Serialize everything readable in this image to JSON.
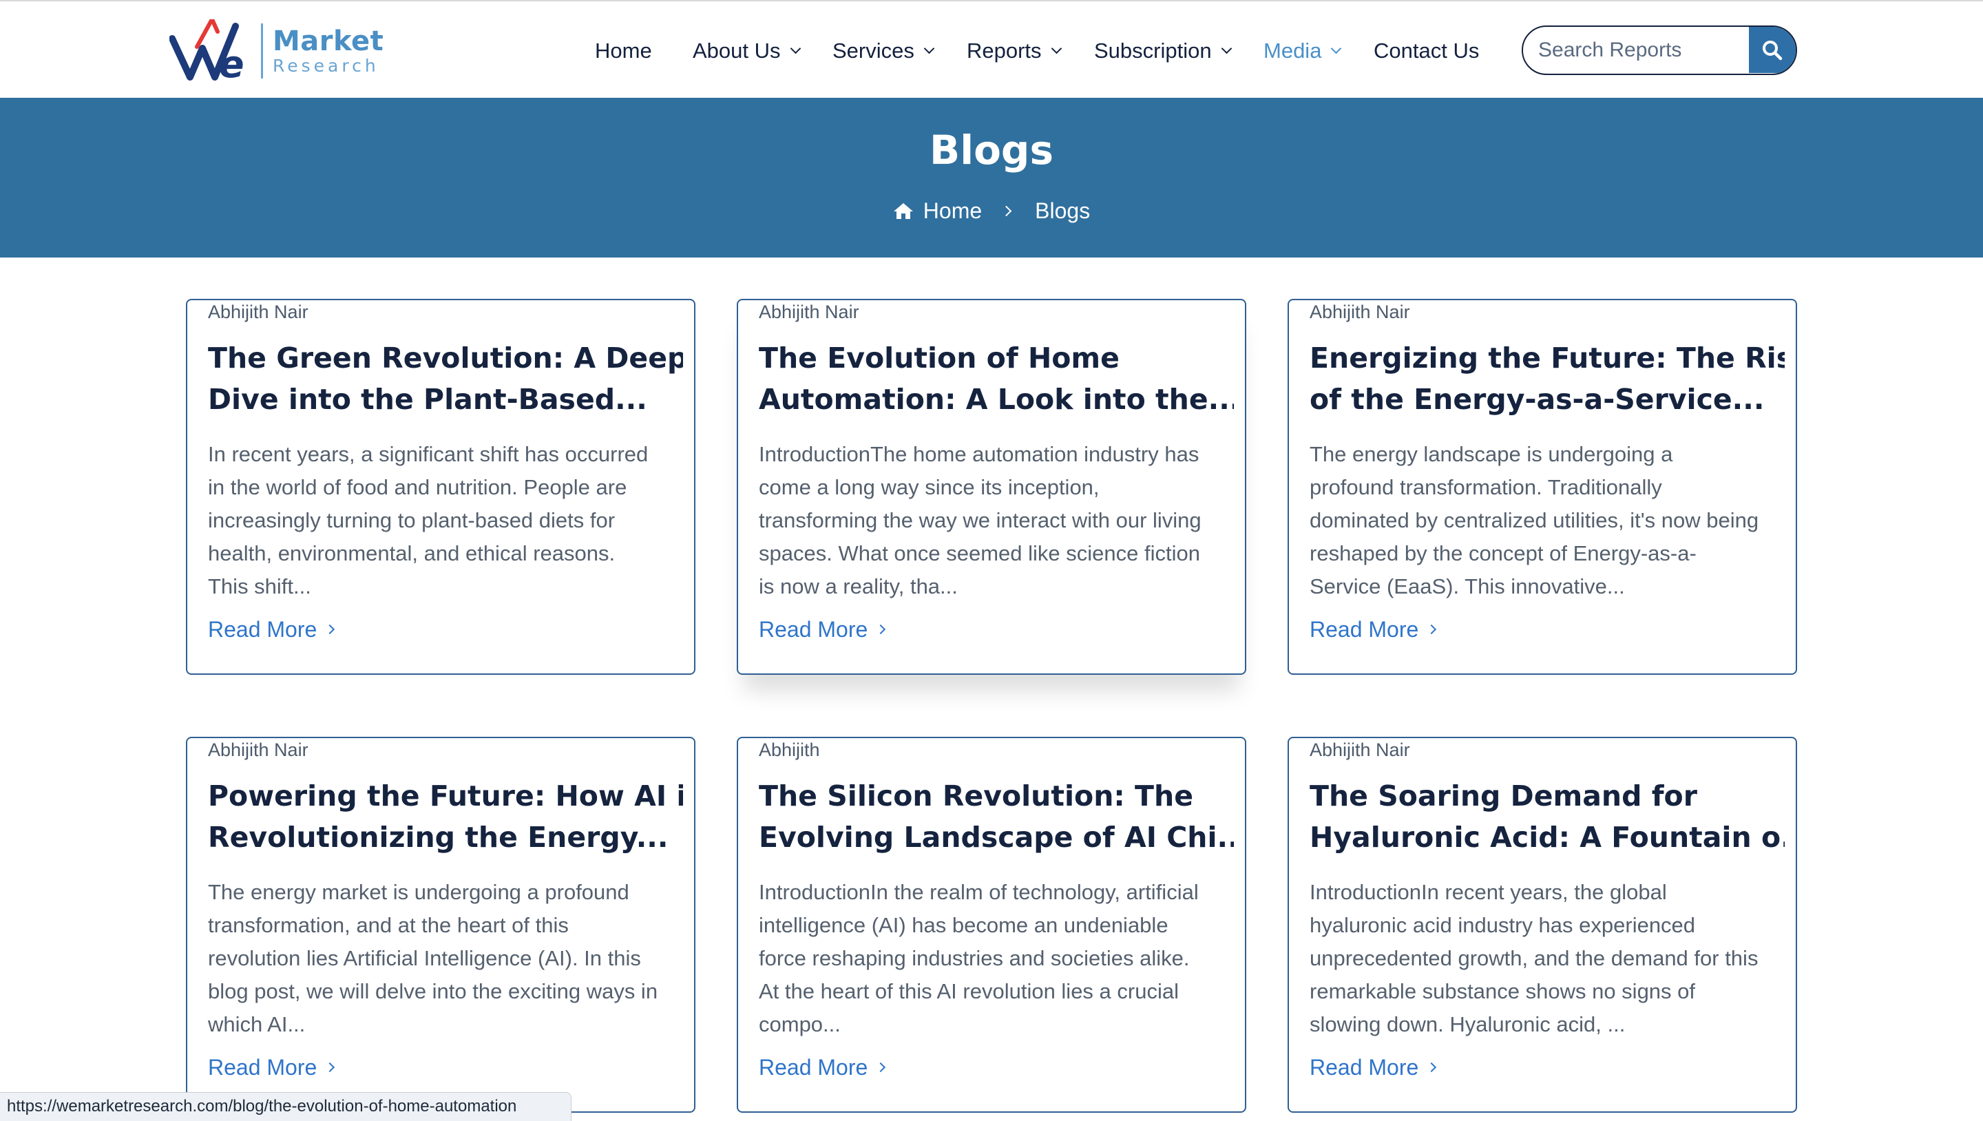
{
  "header": {
    "logo": {
      "mark": "We",
      "market": "Market",
      "research": "Research"
    },
    "nav": [
      {
        "label": "Home",
        "dropdown": false,
        "active": false
      },
      {
        "label": "About Us",
        "dropdown": true,
        "active": false
      },
      {
        "label": "Services",
        "dropdown": true,
        "active": false
      },
      {
        "label": "Reports",
        "dropdown": true,
        "active": false
      },
      {
        "label": "Subscription",
        "dropdown": true,
        "active": false
      },
      {
        "label": "Media",
        "dropdown": true,
        "active": true
      },
      {
        "label": "Contact Us",
        "dropdown": false,
        "active": false
      }
    ],
    "search": {
      "placeholder": "Search Reports",
      "value": "",
      "icon": "search-icon"
    }
  },
  "banner": {
    "title": "Blogs",
    "breadcrumb": {
      "home": "Home",
      "current": "Blogs",
      "home_icon": "home-icon"
    }
  },
  "cards": [
    {
      "author": "Abhijith Nair",
      "title_lines": [
        "The Green Revolution: A Deep",
        "Dive into the Plant-Based..."
      ],
      "excerpt_lines": [
        "In recent years, a significant shift has occurred",
        "in the world of food and nutrition. People are",
        "increasingly turning to plant-based diets for",
        "health, environmental, and ethical reasons.",
        "This shift..."
      ],
      "read_more": "Read More"
    },
    {
      "author": "Abhijith Nair",
      "title_lines": [
        "The Evolution of Home",
        "Automation: A Look into the..."
      ],
      "excerpt_lines": [
        "IntroductionThe home automation industry has",
        "come a long way since its inception,",
        "transforming the way we interact with our living",
        "spaces. What once seemed like science fiction",
        "is now a reality, tha..."
      ],
      "read_more": "Read More"
    },
    {
      "author": "Abhijith Nair",
      "title_lines": [
        "Energizing the Future: The Rise",
        "of the Energy-as-a-Service..."
      ],
      "excerpt_lines": [
        "The energy landscape is undergoing a",
        "profound transformation. Traditionally",
        "dominated by centralized utilities, it's now being",
        "reshaped by the concept of Energy-as-a-",
        "Service (EaaS). This innovative..."
      ],
      "read_more": "Read More"
    },
    {
      "author": "Abhijith Nair",
      "title_lines": [
        "Powering the Future: How AI is",
        "Revolutionizing the Energy..."
      ],
      "excerpt_lines": [
        "The energy market is undergoing a profound",
        "transformation, and at the heart of this",
        "revolution lies Artificial Intelligence (AI). In this",
        "blog post, we will delve into the exciting ways in",
        "which AI..."
      ],
      "read_more": "Read More"
    },
    {
      "author": "Abhijith",
      "title_lines": [
        "The Silicon Revolution: The",
        "Evolving Landscape of AI Chi..."
      ],
      "excerpt_lines": [
        "IntroductionIn the realm of technology, artificial",
        "intelligence (AI) has become an undeniable",
        "force reshaping industries and societies alike.",
        "At the heart of this AI revolution lies a crucial",
        "compo..."
      ],
      "read_more": "Read More"
    },
    {
      "author": "Abhijith Nair",
      "title_lines": [
        "The Soaring Demand for",
        "Hyaluronic Acid: A Fountain o..."
      ],
      "excerpt_lines": [
        "IntroductionIn recent years, the global",
        "hyaluronic acid industry has experienced",
        "unprecedented growth, and the demand for this",
        "remarkable substance shows no signs of",
        "slowing down. Hyaluronic acid, ..."
      ],
      "read_more": "Read More"
    }
  ],
  "statusbar": {
    "url": "https://wemarketresearch.com/blog/the-evolution-of-home-automation"
  },
  "colors": {
    "banner": "#30709e",
    "nav_text": "#14213d",
    "nav_active": "#4a90c9",
    "card_border": "#2f5f94",
    "link": "#2f74c9"
  }
}
